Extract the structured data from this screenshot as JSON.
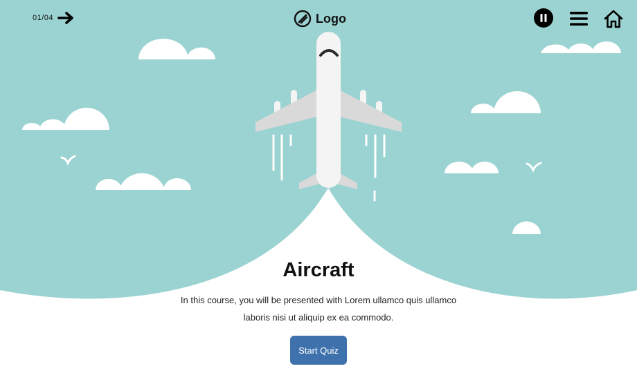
{
  "nav": {
    "counter": "01/04",
    "next_icon": "arrow-right-icon",
    "pause_icon": "pause-icon",
    "menu_icon": "hamburger-menu-icon",
    "home_icon": "home-icon"
  },
  "logo": {
    "text": "Logo",
    "icon": "slash-circle-icon"
  },
  "hero": {
    "title": "Aircraft",
    "description": "In this course, you will be presented with Lorem ullamco quis ullamco laboris nisi ut aliquip ex ea commodo.",
    "start_label": "Start Quiz"
  },
  "colors": {
    "sky": "#9ad3d1",
    "cloud": "#ffffff",
    "plane_body": "#f4f4f4",
    "plane_wing": "#d9d9d9",
    "button": "#3f72ad"
  }
}
